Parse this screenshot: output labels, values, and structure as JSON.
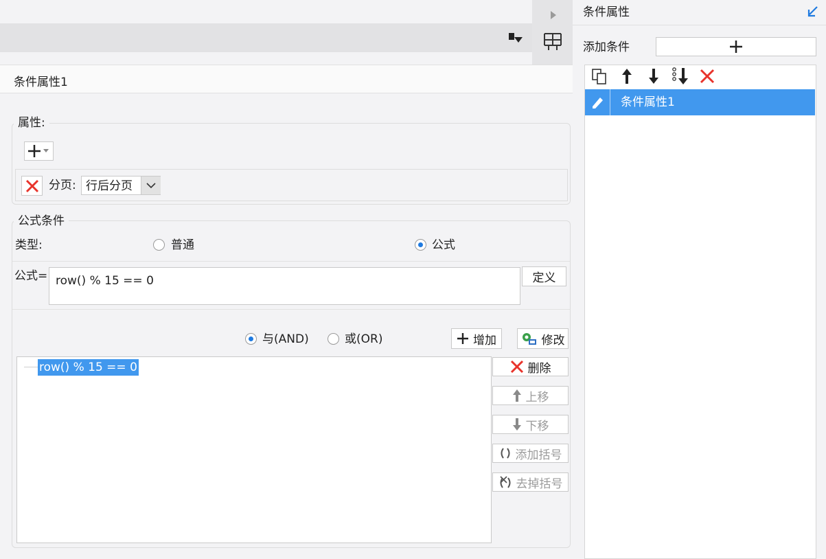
{
  "header": {
    "title": "条件属性1"
  },
  "property_group": {
    "title": "属性:",
    "row_label": "分页:",
    "select_value": "行后分页"
  },
  "formula_group": {
    "title": "公式条件",
    "type_label": "类型:",
    "radio_normal": "普通",
    "radio_formula": "公式",
    "formula_label": "公式=",
    "formula_value": "row() % 15 == 0",
    "define_button": "定义",
    "and_label": "与(AND)",
    "or_label": "或(OR)",
    "add_button": "增加",
    "modify_button": "修改",
    "tree_item": "row() % 15 == 0",
    "delete_button": "删除",
    "move_up_button": "上移",
    "move_down_button": "下移",
    "add_bracket_button": "添加括号",
    "remove_bracket_button": "去掉括号"
  },
  "right_panel": {
    "title": "条件属性",
    "add_condition_label": "添加条件",
    "list_items": [
      "条件属性1"
    ]
  },
  "colors": {
    "selection": "#4198ee",
    "delete_red": "#e8332b",
    "accent_blue": "#1f7ae0"
  }
}
